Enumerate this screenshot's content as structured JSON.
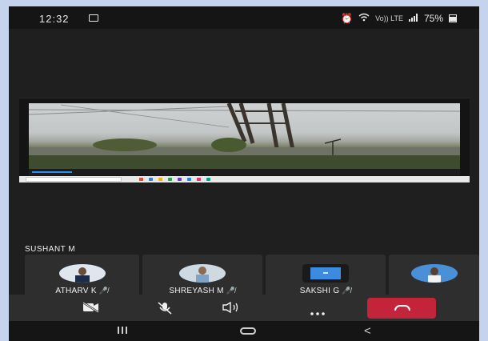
{
  "status_bar": {
    "time": "12:32",
    "network_label": "Vo))\nLTE",
    "battery": "75%"
  },
  "meeting": {
    "presenter_name": "SUSHANT M",
    "participants": [
      {
        "name": "ATHARV K",
        "muted": true
      },
      {
        "name": "SHREYASH M",
        "muted": true
      },
      {
        "name": "SAKSHI G",
        "muted": true
      },
      {
        "name": "",
        "muted": false
      }
    ]
  },
  "toolbar": {
    "buttons": [
      "video-off-icon",
      "mic-off-icon",
      "speaker-icon",
      "more-icon",
      "end-call-icon"
    ],
    "end_call_color": "#c3243a"
  },
  "colors": {
    "background": "#c5d3ec",
    "app_bg": "#1f1f1f",
    "tile_bg": "#2e2e2e"
  }
}
